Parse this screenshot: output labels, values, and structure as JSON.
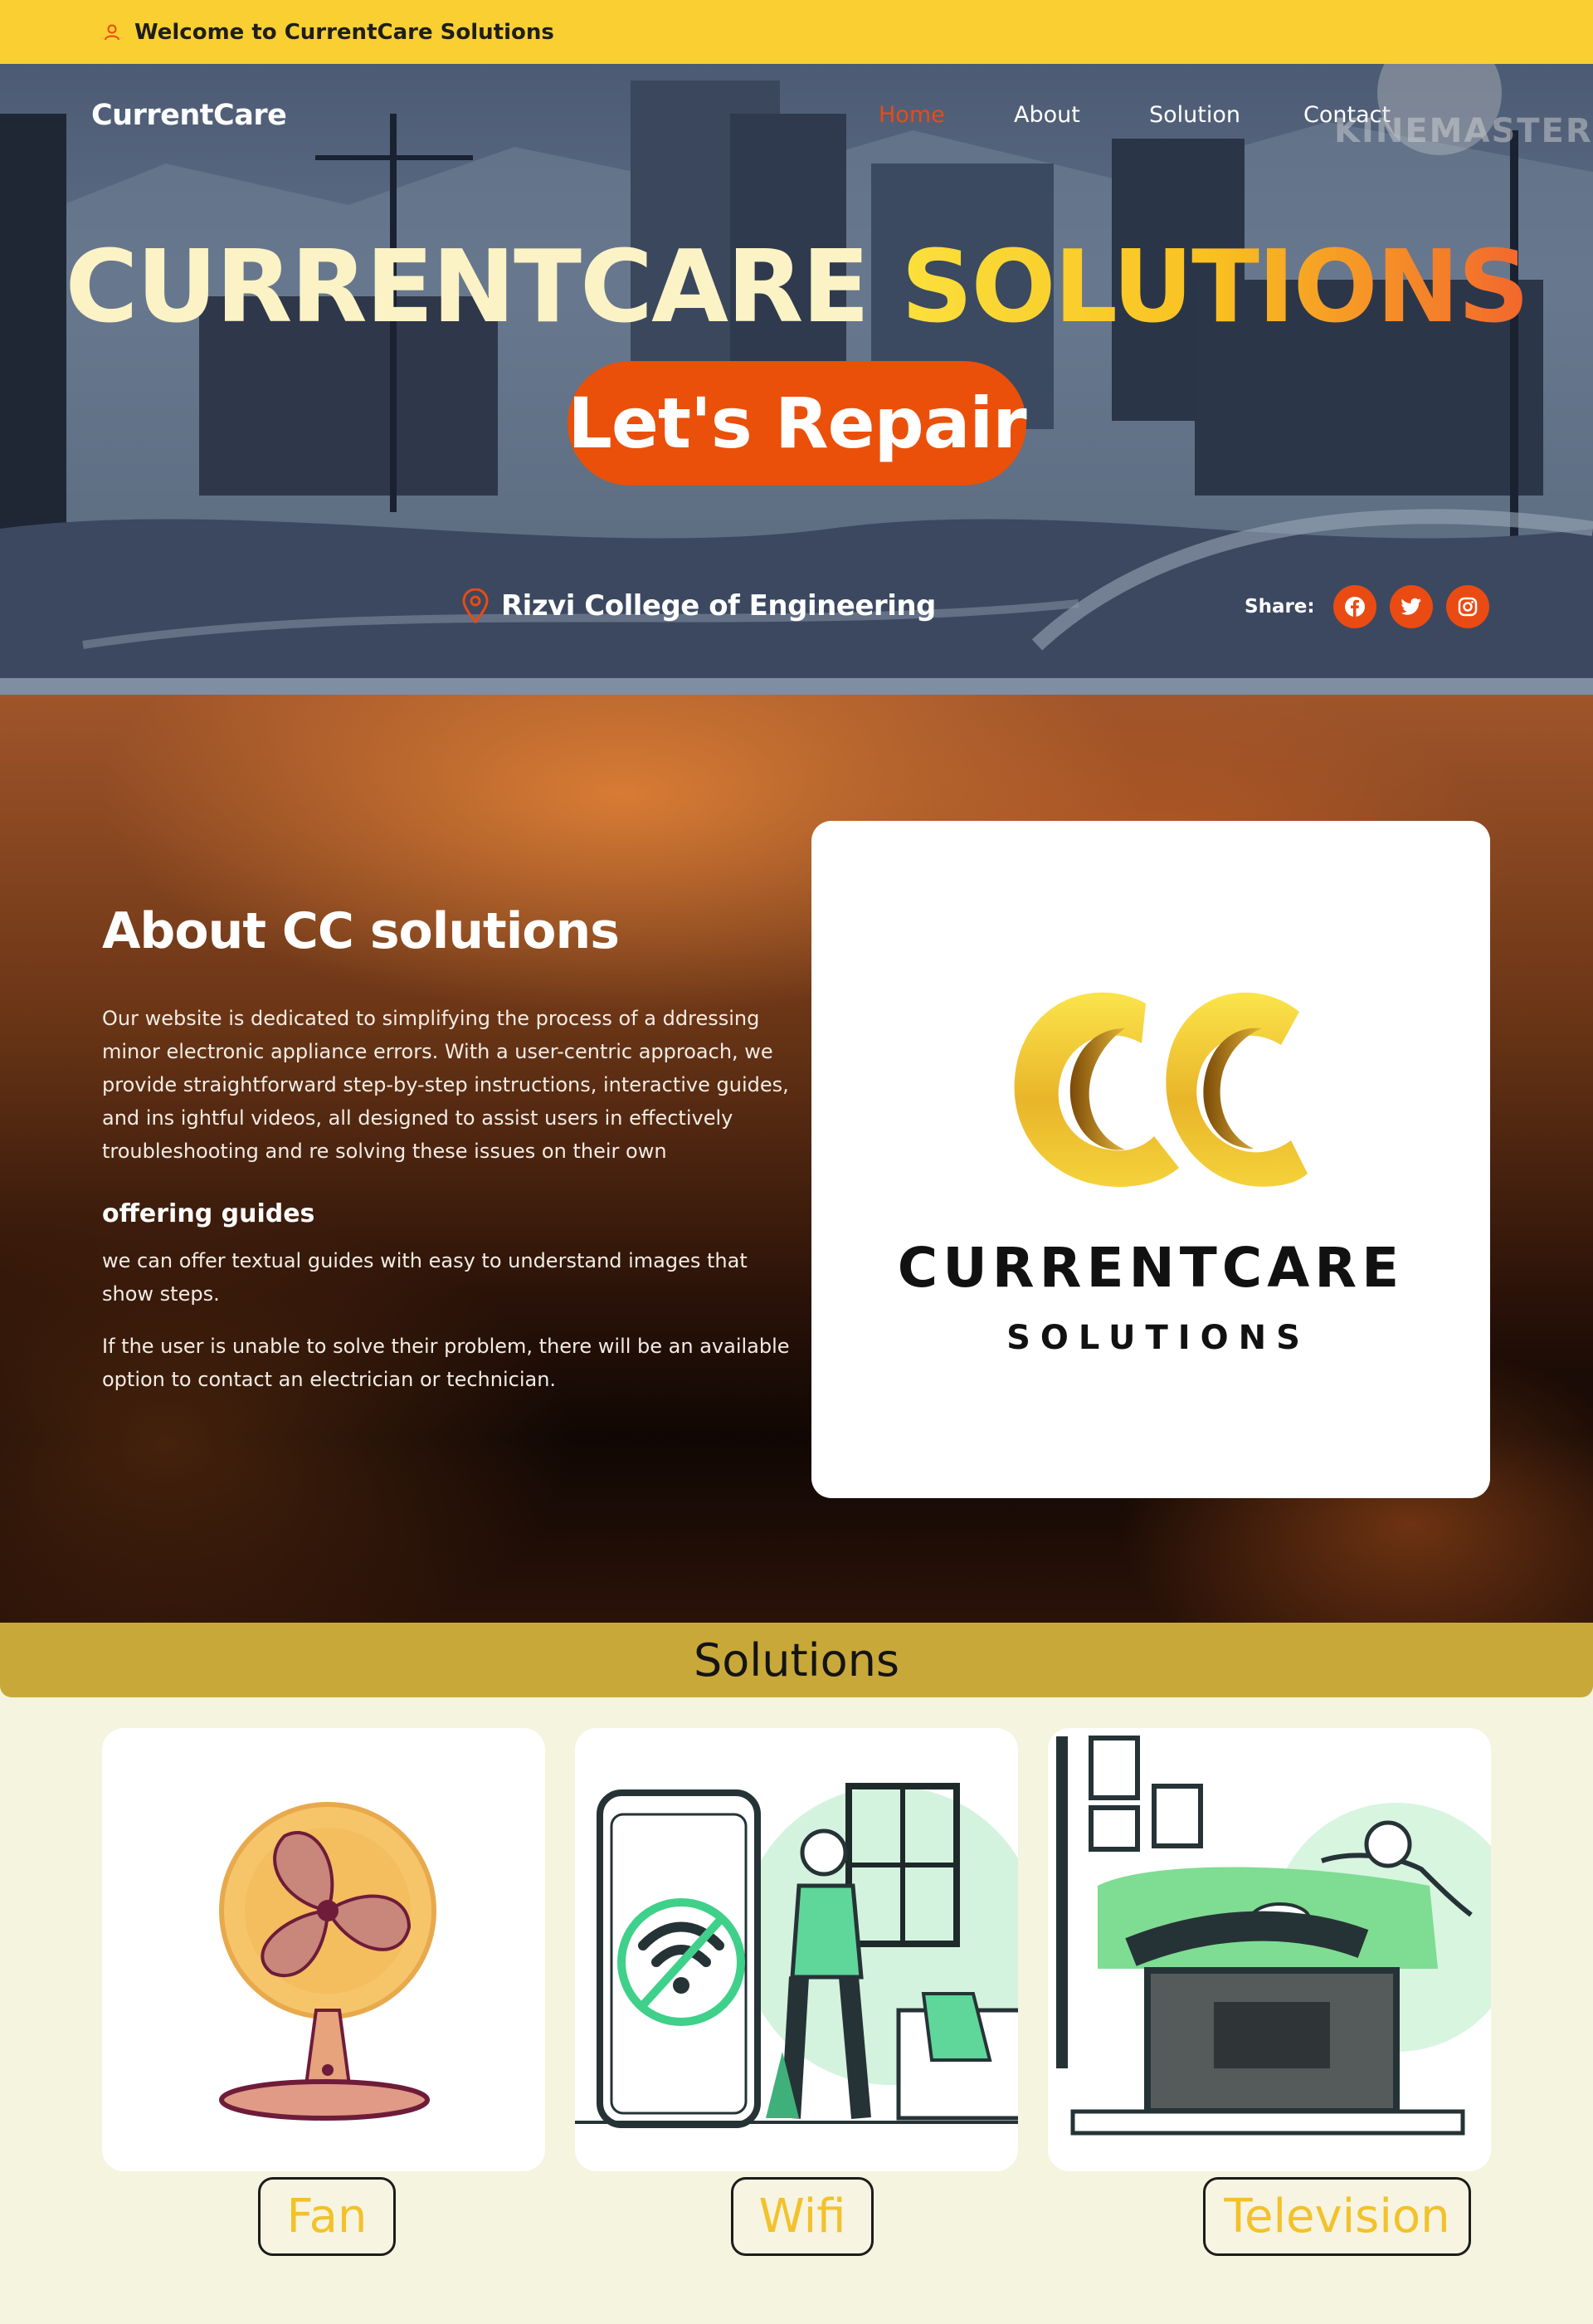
{
  "topbar": {
    "welcome": "Welcome to CurrentCare Solutions",
    "icon": "user-icon"
  },
  "nav": {
    "brand": "CurrentCare",
    "links": [
      "Home",
      "About",
      "Solution",
      "Contact"
    ],
    "active": "Home",
    "watermark": "KINEMASTER"
  },
  "hero": {
    "title_part1": "CURRENTCARE",
    "title_part2": "SOLUTIONS",
    "cta": "Let's Repair",
    "location": "Rizvi College of Engineering",
    "share_label": "Share:",
    "social": [
      "facebook-icon",
      "twitter-icon",
      "instagram-icon"
    ]
  },
  "about": {
    "heading": "About CC solutions",
    "paragraph": "Our website is dedicated to simplifying the process of a ddressing minor electronic appliance errors. With a user-centric approach, we provide straightforward step-by-step instructions, interactive guides, and ins ightful videos, all designed to assist users in effectively troubleshooting and re solving these issues on their own",
    "subheading": "offering guides",
    "guides_text": "we can offer textual guides with easy to understand images that show steps.",
    "contact_text": "If the user is unable to solve their problem, there will be an available option to contact an electrician or technician.",
    "logo_name": "CURRENTCARE",
    "logo_sub": "SOLUTIONS"
  },
  "solutions": {
    "heading": "Solutions",
    "items": [
      {
        "label": "Fan"
      },
      {
        "label": "Wifi"
      },
      {
        "label": "Television"
      }
    ]
  },
  "colors": {
    "accent": "#ea4b12",
    "topbar": "#f9cf31",
    "solutions_bar": "#c9a83a",
    "label_text": "#f3c12a"
  }
}
